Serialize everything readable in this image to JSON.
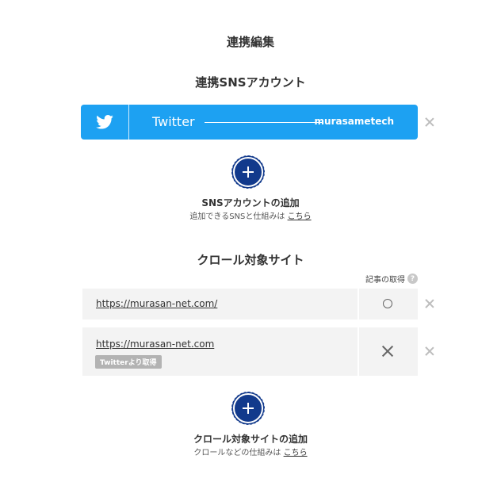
{
  "page": {
    "title": "連携編集"
  },
  "sns": {
    "section_title": "連携SNSアカウント",
    "accounts": [
      {
        "service": "Twitter",
        "handle": "murasametech",
        "icon": "twitter-bird-icon",
        "color": "#1da1f2"
      }
    ],
    "add": {
      "label": "SNSアカウントの追加",
      "help_text": "追加できるSNSと仕組みは",
      "help_link": "こちら"
    }
  },
  "crawl": {
    "section_title": "クロール対象サイト",
    "column_header": "記事の取得",
    "help_icon": "?",
    "sites": [
      {
        "url": "https://murasan-net.com/",
        "fetch_status": "○",
        "status_icon": "circle-icon"
      },
      {
        "url": "https://murasan-net.com",
        "source_badge": "Twitterより取得",
        "fetch_status": "×",
        "status_icon": "cross-icon"
      }
    ],
    "add": {
      "label": "クロール対象サイトの追加",
      "help_text": "クロールなどの仕組みは",
      "help_link": "こちら"
    }
  },
  "colors": {
    "twitter": "#1da1f2",
    "add_button": "#123a8c",
    "row_bg": "#f3f3f3"
  }
}
